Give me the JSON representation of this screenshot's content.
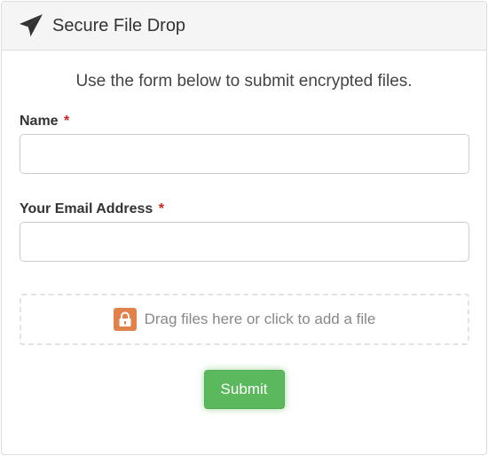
{
  "header": {
    "title": "Secure File Drop",
    "icon": "paper-plane-icon"
  },
  "intro_text": "Use the form below to submit encrypted files.",
  "form": {
    "name_label": "Name",
    "name_value": "",
    "email_label": "Your Email Address",
    "email_value": "",
    "required_marker": "*",
    "dropzone_text": "Drag files here or click to add a file",
    "dropzone_icon": "lock-icon",
    "submit_label": "Submit"
  },
  "colors": {
    "accent_submit": "#5cb85c",
    "required": "#cc2222",
    "lock": "#e0824a"
  }
}
